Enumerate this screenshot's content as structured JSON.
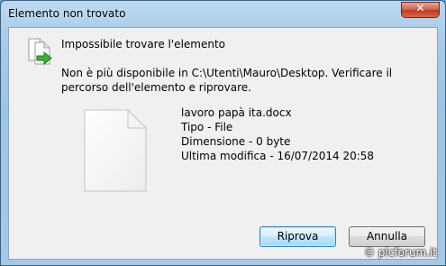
{
  "window": {
    "title": "Elemento non trovato",
    "close_label": "✕"
  },
  "dialog": {
    "heading": "Impossibile trovare l'elemento",
    "message": "Non è più disponibile in C:\\Utenti\\Mauro\\Desktop. Verificare il percorso dell'elemento e riprovare.",
    "file": {
      "name": "lavoro papà ita.docx",
      "type": "Tipo - File",
      "size": "Dimensione - 0 byte",
      "modified": "Ultima modifica - 16/07/2014 20:58"
    },
    "buttons": {
      "retry": "Riprova",
      "cancel": "Annulla"
    }
  },
  "watermark": "© plcforum.it",
  "colors": {
    "frame": "#a9cbe8",
    "client": "#f0f0f0",
    "close": "#c1381f",
    "primary_border": "#3c7fb1"
  },
  "icons": {
    "dialog_icon": "file-move-icon",
    "file_icon": "blank-document-icon",
    "close": "close-icon"
  }
}
